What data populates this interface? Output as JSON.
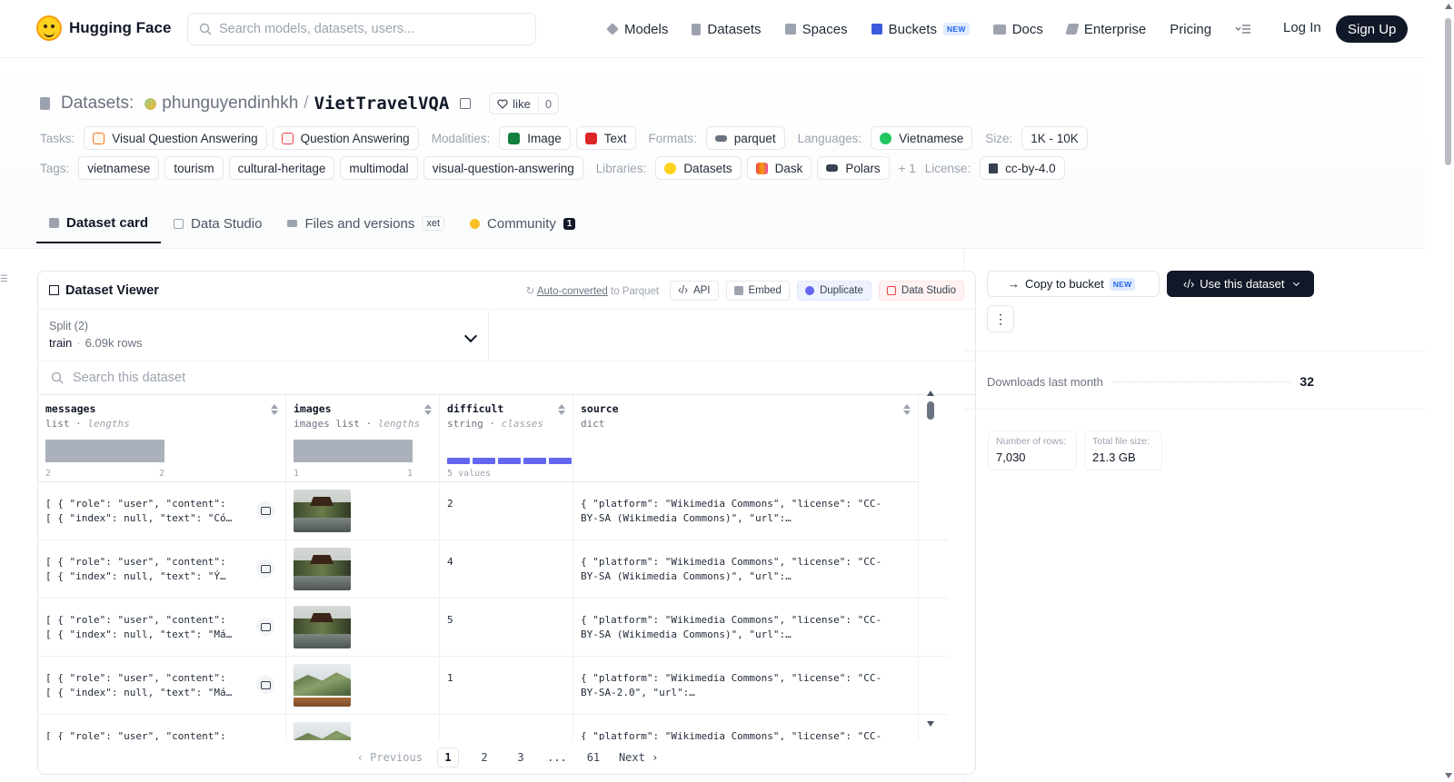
{
  "brand": {
    "name": "Hugging Face"
  },
  "search": {
    "placeholder": "Search models, datasets, users..."
  },
  "nav": {
    "models": "Models",
    "datasets": "Datasets",
    "spaces": "Spaces",
    "buckets": "Buckets",
    "buckets_badge": "NEW",
    "docs": "Docs",
    "enterprise": "Enterprise",
    "pricing": "Pricing",
    "login": "Log In",
    "signup": "Sign Up"
  },
  "repo": {
    "section": "Datasets:",
    "user": "phunguyendinhkh",
    "separator": "/",
    "name": "VietTravelVQA",
    "like_label": "like",
    "like_count": "0"
  },
  "tags": {
    "tasks_label": "Tasks:",
    "tasks": [
      "Visual Question Answering",
      "Question Answering"
    ],
    "modalities_label": "Modalities:",
    "modalities": [
      "Image",
      "Text"
    ],
    "formats_label": "Formats:",
    "formats": [
      "parquet"
    ],
    "languages_label": "Languages:",
    "languages": [
      "Vietnamese"
    ],
    "size_label": "Size:",
    "size": "1K - 10K",
    "tags_label": "Tags:",
    "tags": [
      "vietnamese",
      "tourism",
      "cultural-heritage",
      "multimodal",
      "visual-question-answering"
    ],
    "libraries_label": "Libraries:",
    "libraries": [
      "Datasets",
      "Dask",
      "Polars"
    ],
    "libraries_more": "+ 1",
    "license_label": "License:",
    "license": "cc-by-4.0"
  },
  "tabs": {
    "dataset_card": "Dataset card",
    "data_studio": "Data Studio",
    "files": "Files and versions",
    "files_badge": "xet",
    "community": "Community",
    "community_count": "1"
  },
  "viewer": {
    "title": "Dataset Viewer",
    "auto_link": "Auto-converted",
    "auto_rest": " to Parquet",
    "api": "API",
    "embed": "Embed",
    "duplicate": "Duplicate",
    "data_studio": "Data Studio",
    "split_label": "Split (2)",
    "split_value": "train",
    "split_dot": "·",
    "split_rows": "6.09k rows",
    "search_placeholder": "Search this dataset",
    "columns": [
      {
        "name": "messages",
        "type": "list",
        "stat": "lengths",
        "min": "2",
        "max": "2"
      },
      {
        "name": "images",
        "type": "images list",
        "stat": "lengths",
        "min": "1",
        "max": "1"
      },
      {
        "name": "difficult",
        "type": "string",
        "stat": "classes",
        "footer": "5 values",
        "classes": 5
      },
      {
        "name": "source",
        "type": "dict",
        "stat": ""
      }
    ],
    "type_sep": " · ",
    "rows": [
      {
        "msg1": "[ { \"role\": \"user\", \"content\":",
        "msg2": "[ { \"index\": null, \"text\": \"Có…",
        "difficult": "2",
        "src1": "{ \"platform\": \"Wikimedia Commons\", \"license\": \"CC-",
        "src2": "BY-SA (Wikimedia Commons)\", \"url\":…"
      },
      {
        "msg1": "[ { \"role\": \"user\", \"content\":",
        "msg2": "[ { \"index\": null, \"text\": \"Ý…",
        "difficult": "4",
        "src1": "{ \"platform\": \"Wikimedia Commons\", \"license\": \"CC-",
        "src2": "BY-SA (Wikimedia Commons)\", \"url\":…"
      },
      {
        "msg1": "[ { \"role\": \"user\", \"content\":",
        "msg2": "[ { \"index\": null, \"text\": \"Má…",
        "difficult": "5",
        "src1": "{ \"platform\": \"Wikimedia Commons\", \"license\": \"CC-",
        "src2": "BY-SA (Wikimedia Commons)\", \"url\":…"
      },
      {
        "msg1": "[ { \"role\": \"user\", \"content\":",
        "msg2": "[ { \"index\": null, \"text\": \"Má…",
        "difficult": "1",
        "src1": "{ \"platform\": \"Wikimedia Commons\", \"license\": \"CC-",
        "src2": "BY-SA-2.0\", \"url\":…"
      },
      {
        "msg1": "[ { \"role\": \"user\", \"content\":",
        "msg2": "",
        "difficult": "",
        "src1": "{ \"platform\": \"Wikimedia Commons\", \"license\": \"CC-",
        "src2": ""
      }
    ],
    "pager": {
      "prev": "Previous",
      "pages": [
        "1",
        "2",
        "3",
        "...",
        "61"
      ],
      "next": "Next"
    }
  },
  "sidebar": {
    "copy_bucket": "Copy to bucket",
    "copy_badge": "NEW",
    "use_dataset": "Use this dataset",
    "more": "⋮",
    "downloads_label": "Downloads last month",
    "downloads_value": "32",
    "rows_label": "Number of rows:",
    "rows_value": "7,030",
    "size_label": "Total file size:",
    "size_value": "21.3 GB"
  },
  "colors": {
    "accent": "#111827",
    "class_bar": "#6366f1",
    "logo": "#ffd21e"
  }
}
